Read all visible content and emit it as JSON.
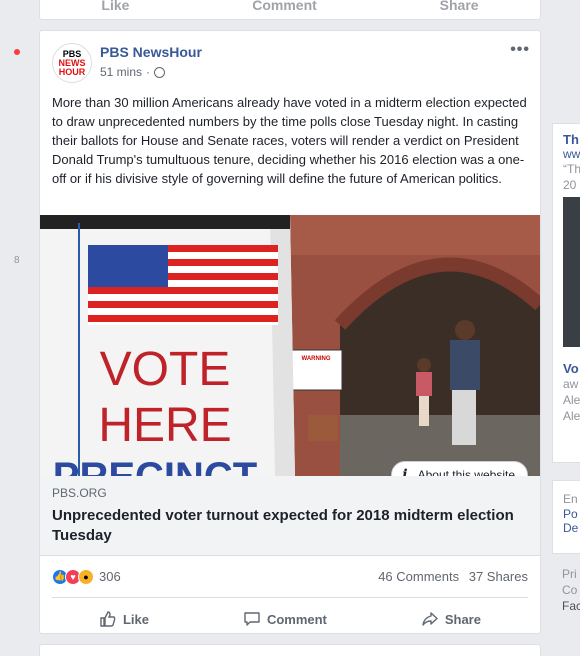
{
  "prev_post": {
    "like_label": "Like",
    "comment_label": "Comment",
    "share_label": "Share"
  },
  "gutter": {
    "number": "8"
  },
  "post": {
    "page_name": "PBS NewsHour",
    "avatar_lines": [
      "PBS",
      "NEWS",
      "HOUR"
    ],
    "time": "51 mins",
    "privacy_icon": "globe-icon",
    "more_icon": "ellipsis-icon",
    "text": "More than 30 million Americans already have voted in a midterm election expected to draw unprecedented numbers by the time polls close Tuesday night. In casting their ballots for House and Senate races, voters will render a verdict on President Donald Trump's tumultuous tenure, deciding whether his 2016 election was a one-off or if his divisive style of governing will define the future of American politics.",
    "image": {
      "sign_line1": "VOTE",
      "sign_line2": "HERE",
      "sign_line3": "PRECINCT",
      "warning_title": "WARNING",
      "warning_body": "NO FIREARMS, WEAPONS, KNIVES, OR ANY OTHER SHARP OBJECT IN A POLLING LOCATION."
    },
    "about_label": "About this website",
    "link": {
      "domain": "PBS.ORG",
      "title": "Unprecedented voter turnout expected for 2018 midterm election Tuesday"
    },
    "reactions": {
      "count": "306",
      "icons": [
        "like-icon",
        "love-icon",
        "wow-icon"
      ]
    },
    "comments": "46 Comments",
    "shares": "37 Shares",
    "actions": {
      "like": "Like",
      "comment": "Comment",
      "share": "Share"
    }
  },
  "right_column": {
    "block1": {
      "title": "Th",
      "url": "ww",
      "line": "“Th",
      "line2": "20",
      "item2_title": "Vo",
      "item2_l1": "aw",
      "item2_l2": "Ale",
      "item2_l3": "Ale"
    },
    "block2": {
      "l1": "En",
      "l2": "Po",
      "l3": "De"
    },
    "block3": {
      "l1": "Pri",
      "l2": "Co",
      "l3": "Fac"
    }
  },
  "colors": {
    "brand_blue": "#385898",
    "like_blue": "#1877f2",
    "notification_red": "#fa3e3e",
    "page_bg": "#e9ebee"
  }
}
